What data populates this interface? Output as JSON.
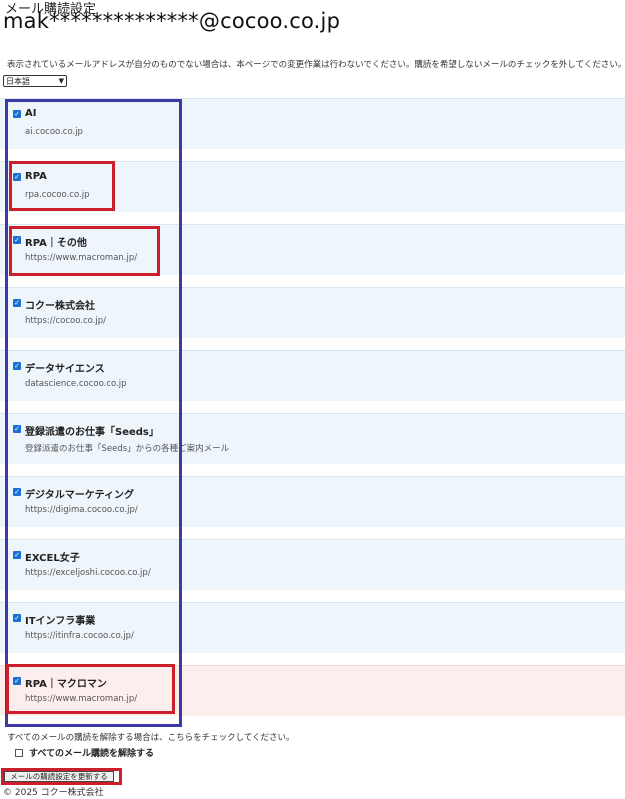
{
  "page": {
    "title": "メール購読設定",
    "email": "mak**************@cocoo.co.jp",
    "notice": "表示されているメールアドレスが自分のものでない場合は、本ページでの変更作業は行わないでください。購読を希望しないメールのチェックを外してください。"
  },
  "language_select": {
    "value": "日本語"
  },
  "subscriptions": [
    {
      "name": "AI",
      "url": "ai.cocoo.co.jp",
      "checked": true
    },
    {
      "name": "RPA",
      "url": "rpa.cocoo.co.jp",
      "checked": true
    },
    {
      "name": "RPA｜その他",
      "url": "https://www.macroman.jp/",
      "checked": true
    },
    {
      "name": "コクー株式会社",
      "url": "https://cocoo.co.jp/",
      "checked": true
    },
    {
      "name": "データサイエンス",
      "url": "datascience.cocoo.co.jp",
      "checked": true
    },
    {
      "name": "登録派遣のお仕事「Seeds」",
      "url": "登録派遣のお仕事「Seeds」からの各種ご案内メール",
      "checked": true
    },
    {
      "name": "デジタルマーケティング",
      "url": "https://digima.cocoo.co.jp/",
      "checked": true
    },
    {
      "name": "EXCEL女子",
      "url": "https://exceljoshi.cocoo.co.jp/",
      "checked": true
    },
    {
      "name": "ITインフラ事業",
      "url": "https://itinfra.cocoo.co.jp/",
      "checked": true
    },
    {
      "name": "RPA｜マクロマン",
      "url": "https://www.macroman.jp/",
      "checked": true
    }
  ],
  "unsubscribe": {
    "note": "すべてのメールの購読を解除する場合は、こちらをチェックしてください。",
    "label": "すべてのメール購読を解除する",
    "checked": false
  },
  "update_button": {
    "label": "メールの購読設定を更新する"
  },
  "footer": {
    "text": "© 2025 コクー株式会社"
  },
  "colors": {
    "row_bg": "#eef5fb",
    "row_highlight_bg": "#fdeeee",
    "annotation_blue": "#3b3aa6",
    "annotation_red": "#cc1f2b",
    "checkbox": "#1a6fd4"
  }
}
